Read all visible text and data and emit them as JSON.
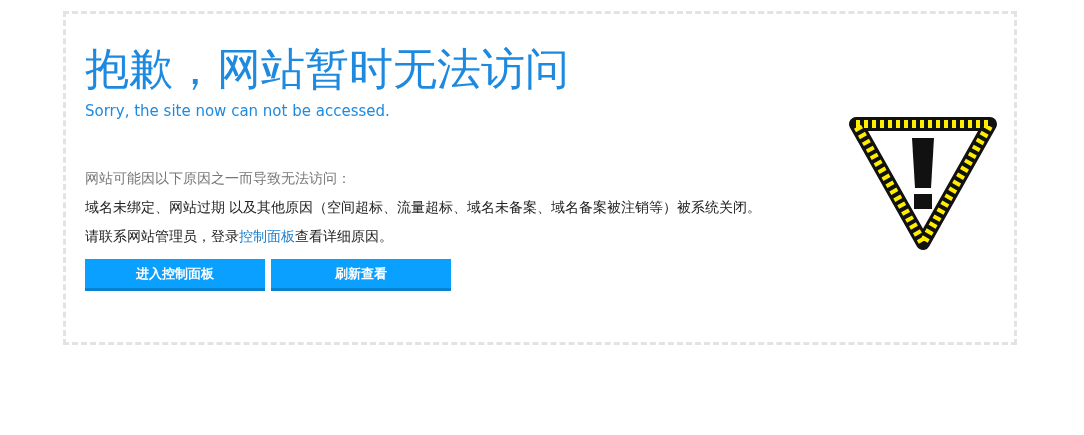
{
  "title": "抱歉，网站暂时无法访问",
  "subtitle": "Sorry, the site now can not be accessed.",
  "intro": "网站可能因以下原因之一而导致无法访问：",
  "reasons": "域名未绑定、网站过期 以及其他原因（空间超标、流量超标、域名未备案、域名备案被注销等）被系统关闭。",
  "contact": {
    "before": "请联系网站管理员，登录",
    "link": "控制面板",
    "after": "查看详细原因。"
  },
  "buttons": [
    "进入控制面板",
    "刷新查看"
  ]
}
